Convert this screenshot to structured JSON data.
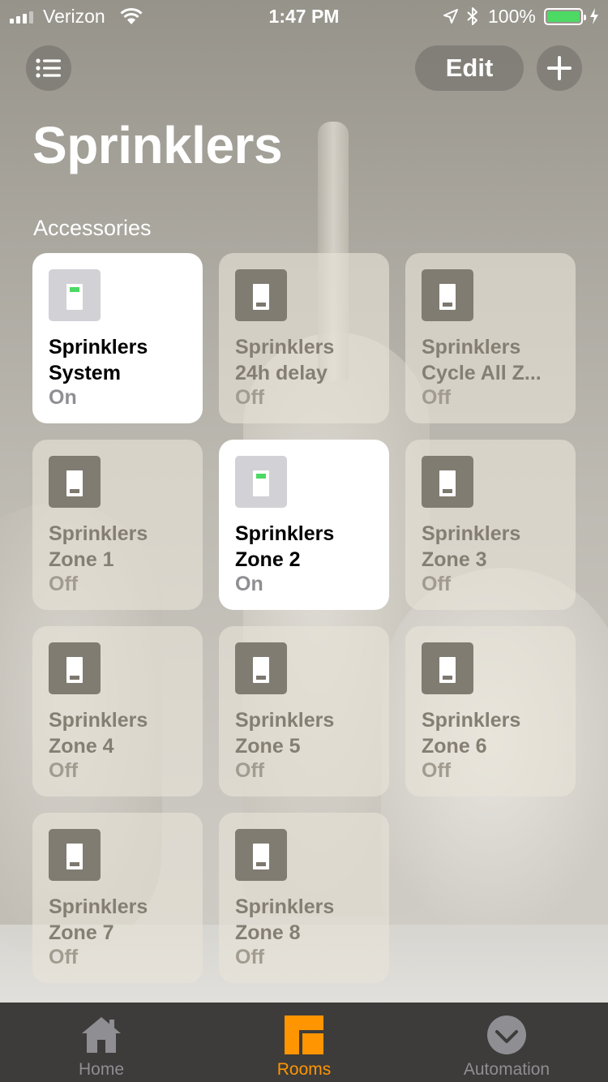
{
  "status_bar": {
    "carrier": "Verizon",
    "time": "1:47 PM",
    "battery": "100%",
    "icons": [
      "signal-icon",
      "wifi-icon",
      "location-icon",
      "bluetooth-icon",
      "battery-icon",
      "charging-icon"
    ]
  },
  "nav": {
    "list_icon": "list-icon",
    "edit_label": "Edit",
    "add_icon": "plus-icon"
  },
  "page_title": "Sprinklers",
  "section_title": "Accessories",
  "accessories": [
    {
      "name_line1": "Sprinklers",
      "name_line2": "System",
      "state": "On",
      "on": true
    },
    {
      "name_line1": "Sprinklers",
      "name_line2": "24h delay",
      "state": "Off",
      "on": false
    },
    {
      "name_line1": "Sprinklers",
      "name_line2": "Cycle All Z...",
      "state": "Off",
      "on": false
    },
    {
      "name_line1": "Sprinklers",
      "name_line2": "Zone 1",
      "state": "Off",
      "on": false
    },
    {
      "name_line1": "Sprinklers",
      "name_line2": "Zone 2",
      "state": "On",
      "on": true
    },
    {
      "name_line1": "Sprinklers",
      "name_line2": "Zone 3",
      "state": "Off",
      "on": false
    },
    {
      "name_line1": "Sprinklers",
      "name_line2": "Zone 4",
      "state": "Off",
      "on": false
    },
    {
      "name_line1": "Sprinklers",
      "name_line2": "Zone 5",
      "state": "Off",
      "on": false
    },
    {
      "name_line1": "Sprinklers",
      "name_line2": "Zone 6",
      "state": "Off",
      "on": false
    },
    {
      "name_line1": "Sprinklers",
      "name_line2": "Zone 7",
      "state": "Off",
      "on": false
    },
    {
      "name_line1": "Sprinklers",
      "name_line2": "Zone 8",
      "state": "Off",
      "on": false
    }
  ],
  "tab_bar": {
    "tabs": [
      {
        "label": "Home",
        "icon": "home-icon",
        "active": false
      },
      {
        "label": "Rooms",
        "icon": "rooms-icon",
        "active": true
      },
      {
        "label": "Automation",
        "icon": "automation-icon",
        "active": false
      }
    ]
  },
  "colors": {
    "accent": "#ff9500",
    "switch_on": "#4cd964",
    "tile_on_bg": "#ffffff",
    "tab_bar_bg": "#3d3c3a"
  }
}
